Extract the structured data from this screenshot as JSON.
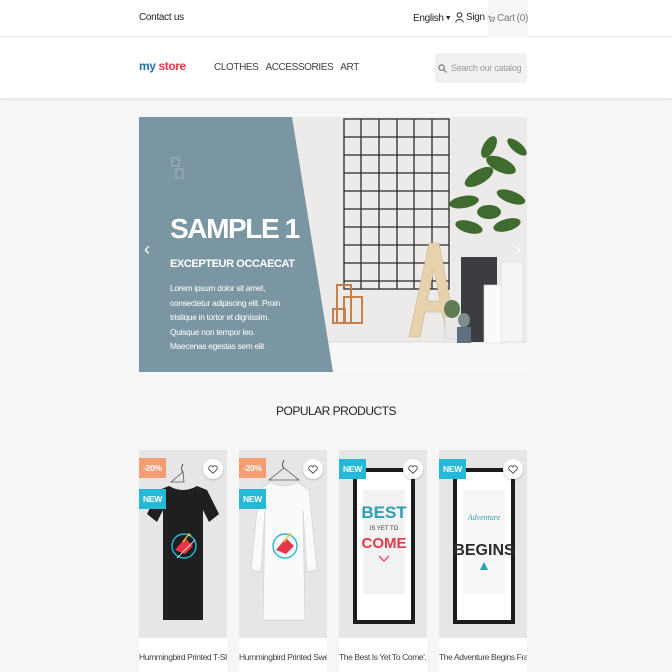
{
  "topbar": {
    "contact": "Contact us",
    "language": "English",
    "signin": "Sign in",
    "cart": "Cart",
    "cart_count": "(0)"
  },
  "header": {
    "logo_my": "my",
    "logo_store": "store",
    "nav": [
      "CLOTHES",
      "ACCESSORIES",
      "ART"
    ],
    "search_placeholder": "Search our catalog"
  },
  "slider": {
    "title": "SAMPLE 1",
    "subtitle": "EXCEPTEUR OCCAECAT",
    "text": "Lorem ipsum dolor sit amet, consectetur adipiscing elit. Proin tristique in tortor et dignissim. Quisque non tempor leo. Maecenas egestas sem elit",
    "panel_color": "#7b96a3"
  },
  "popular": {
    "title": "POPULAR PRODUCTS",
    "products": [
      {
        "name": "Hummingbird Printed T-Shirt",
        "discount": "-20%",
        "flag": "NEW",
        "wishlist": "heart-icon"
      },
      {
        "name": "Hummingbird Printed Sweater",
        "discount": "-20%",
        "flag": "NEW",
        "wishlist": "heart-icon"
      },
      {
        "name": "The Best Is Yet To Come'...",
        "discount": "",
        "flag": "NEW",
        "wishlist": "heart-icon"
      },
      {
        "name": "The Adventure Begins Framed...",
        "discount": "",
        "flag": "NEW",
        "wishlist": "heart-icon"
      }
    ]
  },
  "colors": {
    "discount": "#f39d72",
    "new": "#24b9d7",
    "accent": "#24b9d7"
  }
}
